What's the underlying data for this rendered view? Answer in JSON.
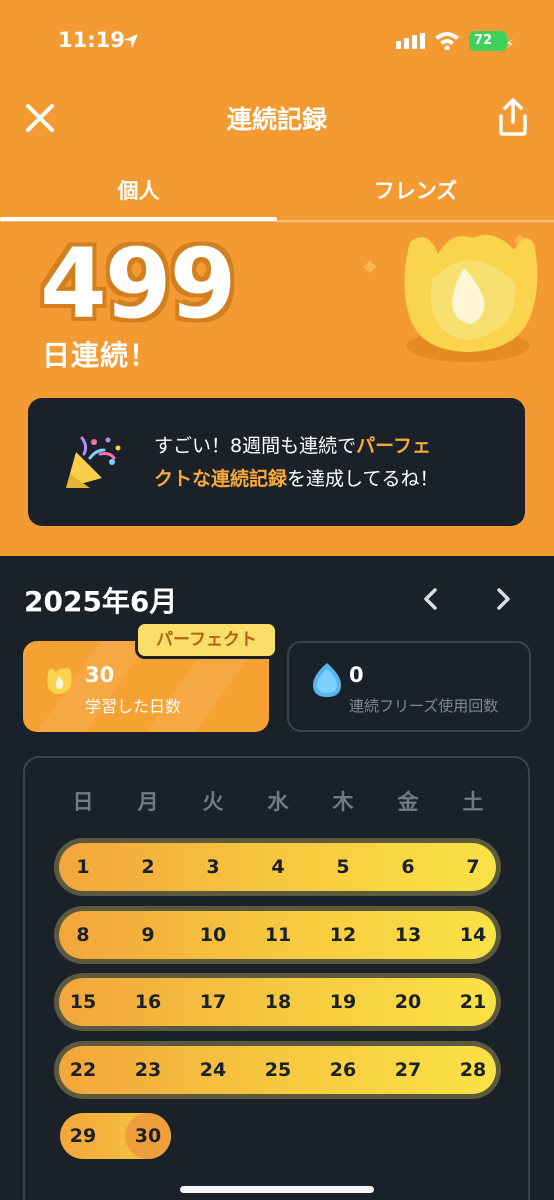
{
  "status_bar": {
    "time": "11:19",
    "battery": "72"
  },
  "header": {
    "title": "連続記録"
  },
  "tabs": [
    {
      "label": "個人",
      "active": true
    },
    {
      "label": "フレンズ",
      "active": false
    }
  ],
  "streak": {
    "count": "499",
    "label": "日連続！"
  },
  "banner": {
    "text_1": "すごい！8週間も連続で",
    "highlight_1": "パーフェ",
    "highlight_2": "クトな連続記録",
    "text_2": "を達成してるね！"
  },
  "calendar": {
    "month": "2025年6月",
    "stats": {
      "badge": "パーフェクト",
      "days_count": "30",
      "days_label": "学習した日数",
      "freeze_count": "0",
      "freeze_label": "連続フリーズ使用回数"
    },
    "weekdays": [
      "日",
      "月",
      "火",
      "水",
      "木",
      "金",
      "土"
    ],
    "weeks": [
      [
        "1",
        "2",
        "3",
        "4",
        "5",
        "6",
        "7"
      ],
      [
        "8",
        "9",
        "10",
        "11",
        "12",
        "13",
        "14"
      ],
      [
        "15",
        "16",
        "17",
        "18",
        "19",
        "20",
        "21"
      ],
      [
        "22",
        "23",
        "24",
        "25",
        "26",
        "27",
        "28"
      ],
      [
        "29",
        "30"
      ]
    ]
  },
  "colors": {
    "accent": "#f39b32",
    "dark_bg": "#1b2128",
    "highlight": "#f8a93a"
  },
  "icons": [
    "location-arrow-icon",
    "signal-icon",
    "wifi-icon",
    "close-icon",
    "share-icon",
    "flame-icon",
    "party-popper-icon",
    "chevron-left-icon",
    "chevron-right-icon",
    "water-drop-icon"
  ]
}
